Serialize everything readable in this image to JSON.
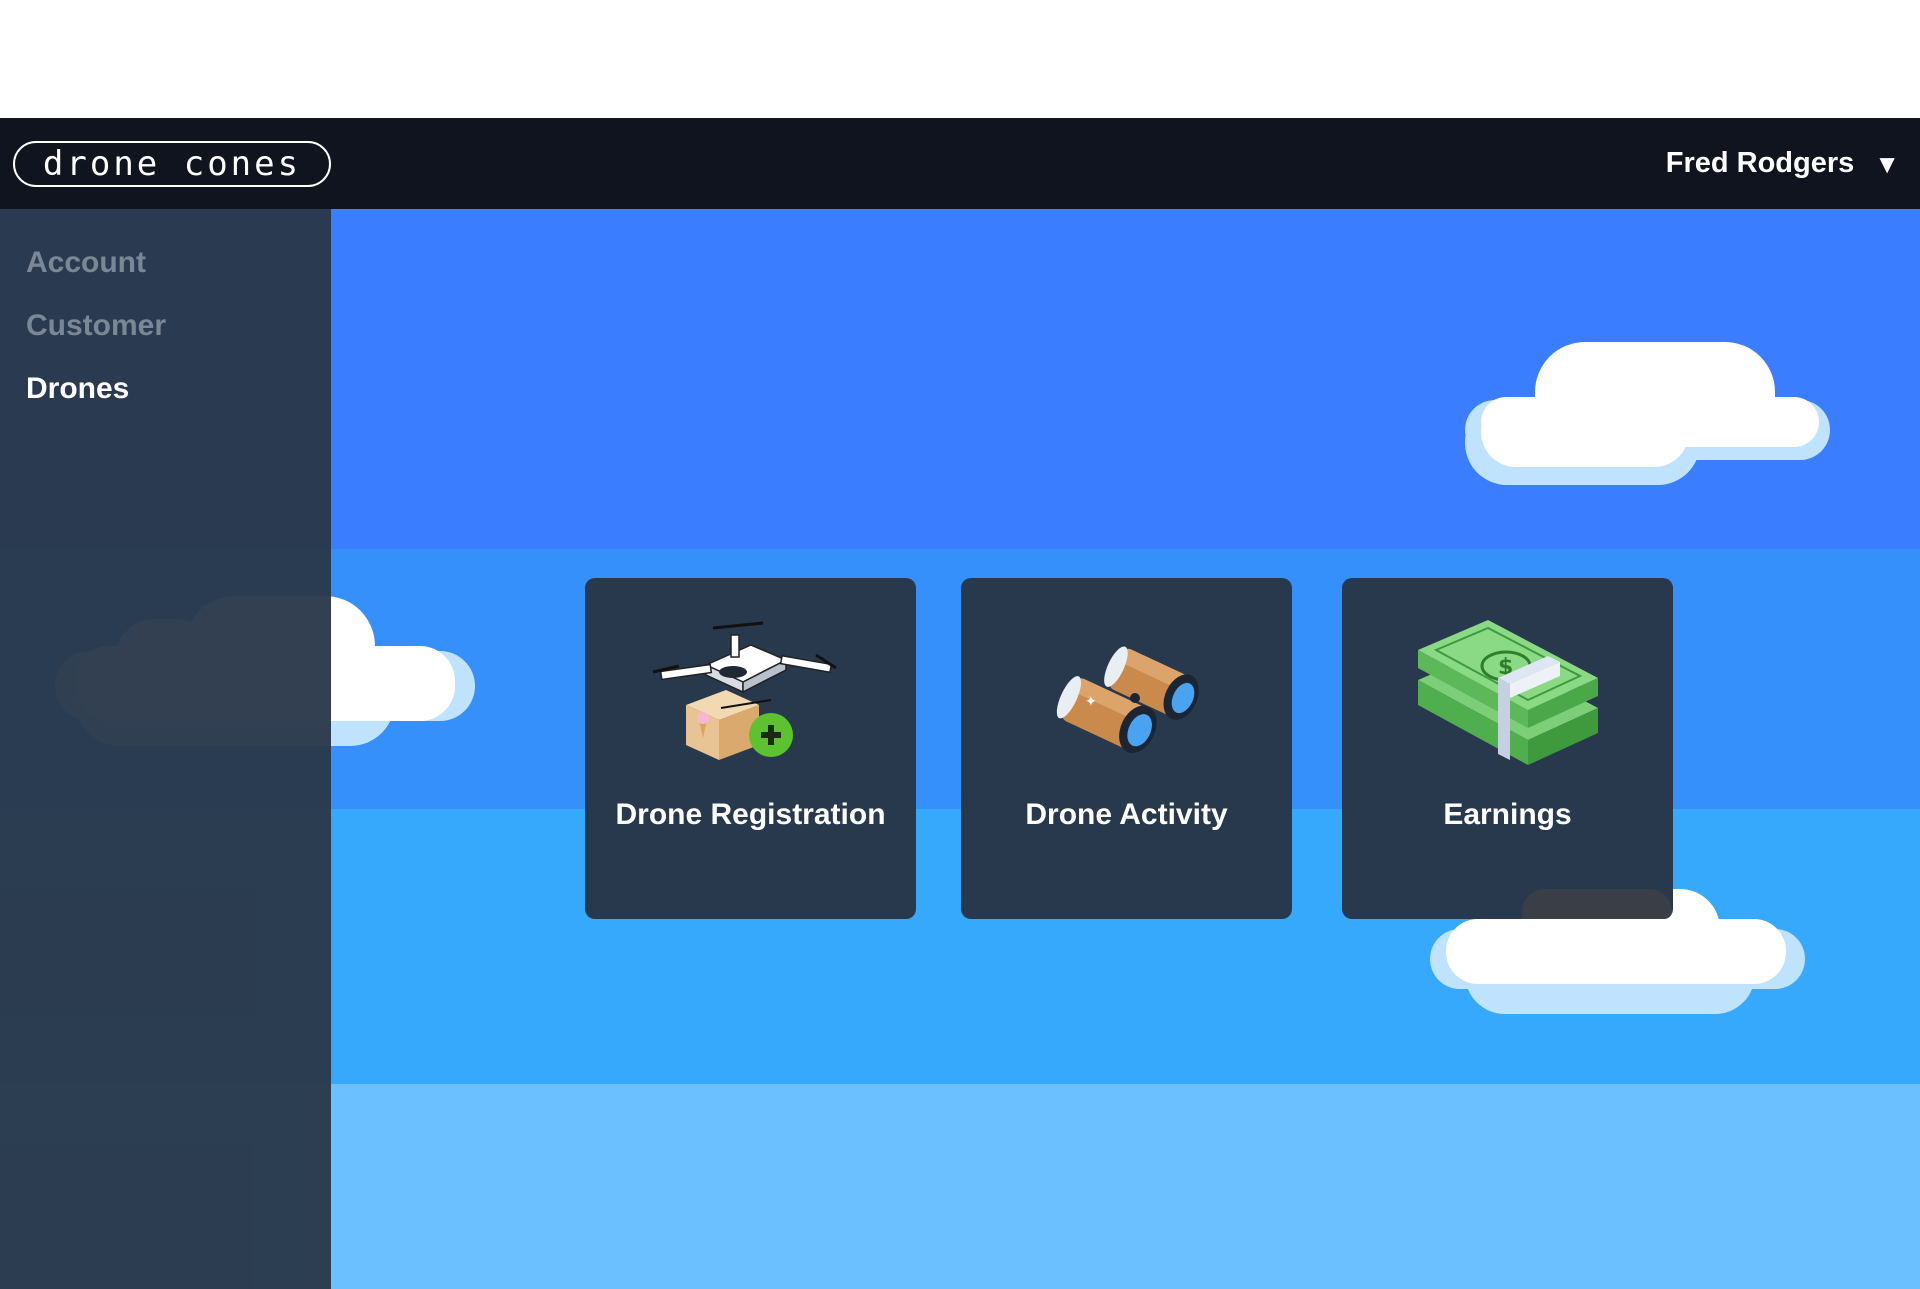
{
  "header": {
    "logo_text": "drone cones",
    "user_name": "Fred Rodgers",
    "user_menu_caret": "▼"
  },
  "sidebar": {
    "items": [
      {
        "label": "Account",
        "active": false
      },
      {
        "label": "Customer",
        "active": false
      },
      {
        "label": "Drones",
        "active": true
      }
    ]
  },
  "cards": [
    {
      "label": "Drone Registration",
      "icon": "drone-package-plus-icon"
    },
    {
      "label": "Drone Activity",
      "icon": "binoculars-icon"
    },
    {
      "label": "Earnings",
      "icon": "money-stack-icon"
    }
  ],
  "colors": {
    "header_bg": "#10141f",
    "sidebar_bg": "#2a384a",
    "card_bg": "#29394d",
    "sky_top": "#3a7dff",
    "sky_mid": "#3690fb",
    "sky_low": "#37a9fd",
    "sky_bottom": "#6bc1ff",
    "accent_green": "#5cc22f"
  }
}
